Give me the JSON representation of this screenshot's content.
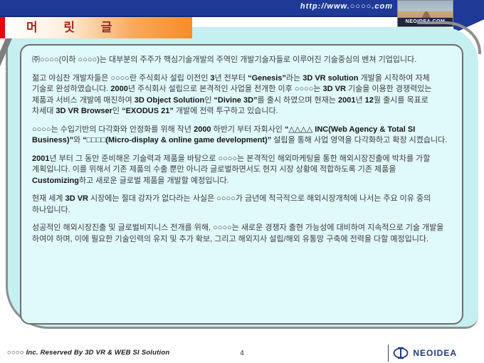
{
  "header": {
    "url": "http://www.○○○○.com",
    "badge_label": "NEOIDEA.COM"
  },
  "title": {
    "text": "머 릿 글"
  },
  "content": {
    "paragraphs": [
      [
        {
          "t": "㈜○○○○(이하 ○○○○)는 대부분의 주주가 핵심기술개발의 주역인 개발기술자들로 이루어진 기술중심의 벤쳐 기업입니다.",
          "b": false
        }
      ],
      [
        {
          "t": "젊고 야심찬 개발자들은 ○○○○란 주식회사 설립 이전인 ",
          "b": false
        },
        {
          "t": "3",
          "b": true
        },
        {
          "t": "년 전부터 ",
          "b": false
        },
        {
          "t": "“Genesis”",
          "b": true
        },
        {
          "t": "라는 ",
          "b": false
        },
        {
          "t": "3D VR solution",
          "b": true
        },
        {
          "t": " 개발을 시작하여 자체 기술로 완성하였습니다. ",
          "b": false
        },
        {
          "t": "2000",
          "b": true
        },
        {
          "t": "년 주식회사 설립으로 본격적인 사업을 전개한 이후 ○○○○는 ",
          "b": false
        },
        {
          "t": "3D VR",
          "b": true
        },
        {
          "t": " 기술을 이용한 경쟁력있는 제품과 서비스 개발에 매진하여 ",
          "b": false
        },
        {
          "t": "3D Object Solution",
          "b": true
        },
        {
          "t": "인 ",
          "b": false
        },
        {
          "t": "“Divine 3D”",
          "b": true
        },
        {
          "t": "를 출시 하였으며 현재는 ",
          "b": false
        },
        {
          "t": "2001",
          "b": true
        },
        {
          "t": "년 ",
          "b": false
        },
        {
          "t": "12",
          "b": true
        },
        {
          "t": "월 출시를 목표로 차세대 ",
          "b": false
        },
        {
          "t": "3D VR Browser",
          "b": true
        },
        {
          "t": "인 ",
          "b": false
        },
        {
          "t": "“EXODUS 21”",
          "b": true
        },
        {
          "t": " 개발에 전력 투구하고 있습니다.",
          "b": false
        }
      ],
      [
        {
          "t": "○○○○는 수입기반의 다각화와 안정화를 위해 작년 ",
          "b": false
        },
        {
          "t": "2000",
          "b": true
        },
        {
          "t": " 하반기 부터 자회사인 ",
          "b": false
        },
        {
          "t": "“△△△△ INC(Web Agency & Total SI Business)”",
          "b": true
        },
        {
          "t": "와 ",
          "b": false
        },
        {
          "t": "“□□□□(Micro-display & online game development)”",
          "b": true
        },
        {
          "t": " 설립을 통해 사업 영역을 다각화하고 확장 시켰습니다.",
          "b": false
        }
      ],
      [
        {
          "t": "2001",
          "b": true
        },
        {
          "t": "년 부터 그 동안 준비해온 기술력과 제품을 바탕으로 ○○○○는 본격적인 해외마케팅을 통한 해외시장진출에 박차를 가할 계획입니다. 이를 위해서 기존 제품의 수출 뿐만 아니라 글로벌하면서도 현지 시장 상황에 적합하도록 기존 제품을 ",
          "b": false
        },
        {
          "t": "Customizing",
          "b": true
        },
        {
          "t": "하고 새로운 글로벌 제품을 개발할 예정입니다.",
          "b": false
        }
      ],
      [
        {
          "t": "현재 세계 ",
          "b": false
        },
        {
          "t": "3D VR",
          "b": true
        },
        {
          "t": " 시장에는 절대 강자가 없다라는 사실은 ○○○○가 금년에 적극적으로 해외시장개척에 나서는 주요 이유 중의 하나입니다.",
          "b": false
        }
      ],
      [
        {
          "t": "성공적인 해외시장진출 및 글로벌비지니스 전개를 위해, ○○○○는 새로운 경쟁자 출현 가능성에 대비하여 지속적으로 기술 개발을 하여야 하며, 이에 필요한 기술인력의 유지 및 추가 확보, 그리고 해외지사 설립/해외 유통망 구축에 전력을 다할 예정입니다.",
          "b": false
        }
      ]
    ]
  },
  "footer": {
    "copyright": "○○○○ Inc. Reserved By 3D VR & WEB SI Solution",
    "page_number": "4",
    "logo_text": "NEOIDEA"
  },
  "colors": {
    "navy": "#1E3A96",
    "accent_red": "#E8000D",
    "accent_orange": "#F68C28",
    "title_red": "#9B2D25",
    "panel_cyan": "#C6EFF0",
    "box_cyan": "#E0F9F9"
  }
}
